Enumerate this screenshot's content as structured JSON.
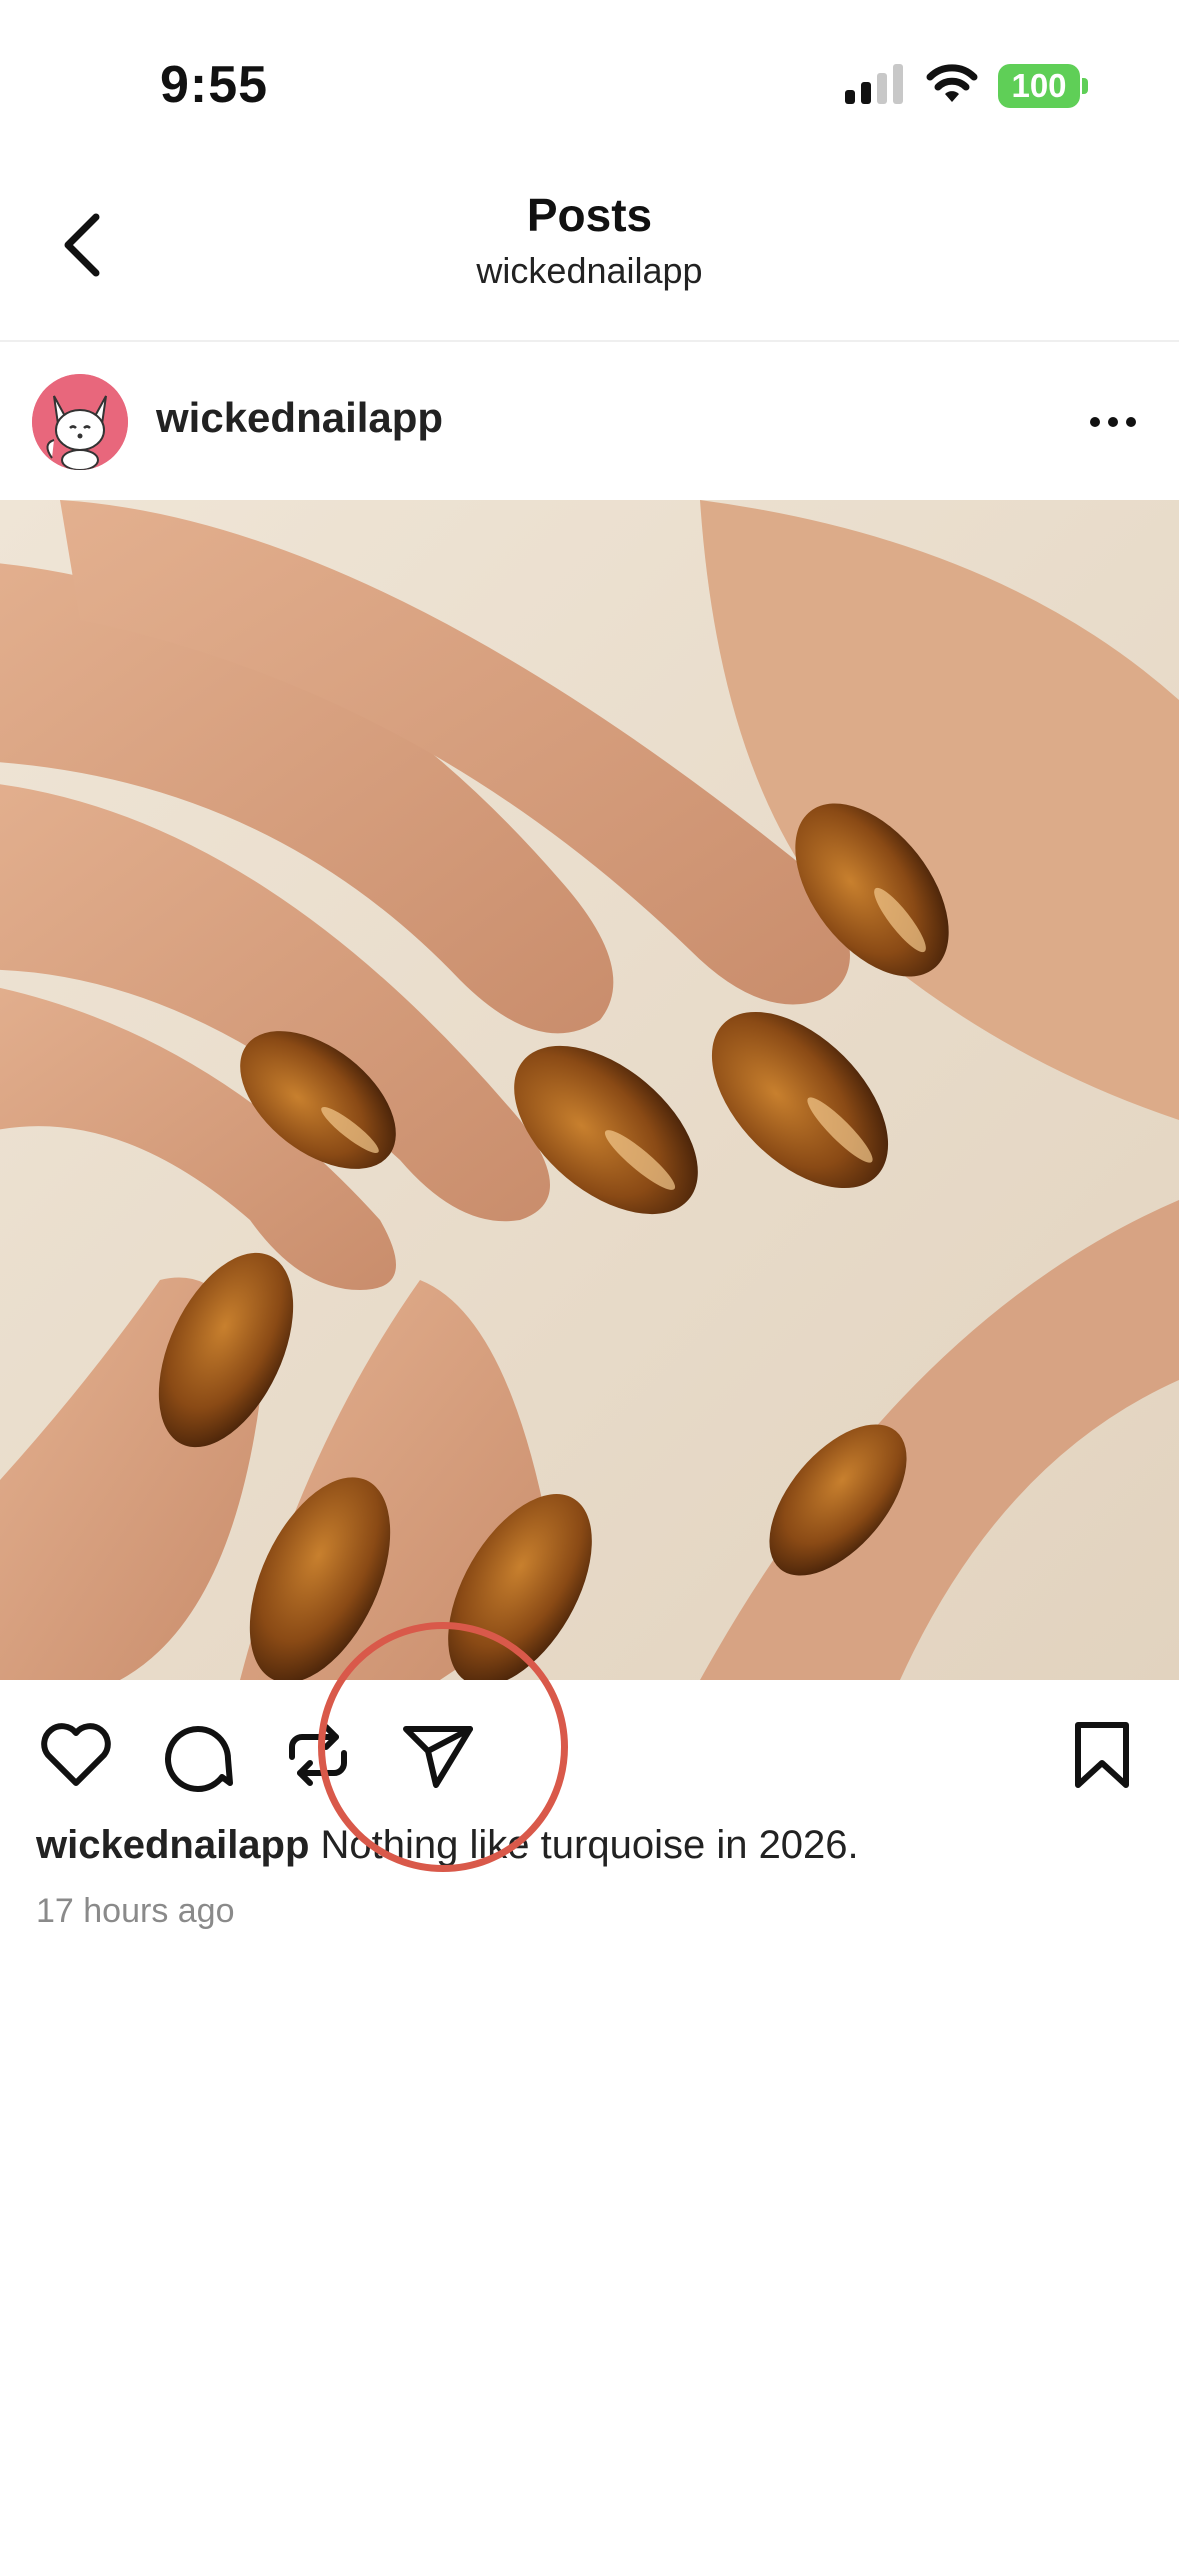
{
  "status_bar": {
    "time": "9:55",
    "battery": "100",
    "icons": [
      "signal-icon",
      "wifi-icon",
      "battery-icon"
    ],
    "battery_color": "#5fcf57"
  },
  "nav": {
    "title": "Posts",
    "subtitle": "wickednailapp",
    "back_icon": "chevron-left-icon"
  },
  "post": {
    "username": "wickednailapp",
    "avatar_icon": "fox-avatar-icon",
    "more_icon": "more-horizontal-icon",
    "image_alt": "tortoiseshell-nails-image",
    "actions": [
      "heart-icon",
      "comment-icon",
      "repost-icon",
      "send-icon",
      "bookmark-icon"
    ],
    "caption_user": "wickednailapp",
    "caption_text": " Nothing like turquoise in 2026.",
    "timestamp": "17 hours ago"
  },
  "annotation": {
    "highlight_color": "#d9594a",
    "highlight_target": "send-icon"
  }
}
